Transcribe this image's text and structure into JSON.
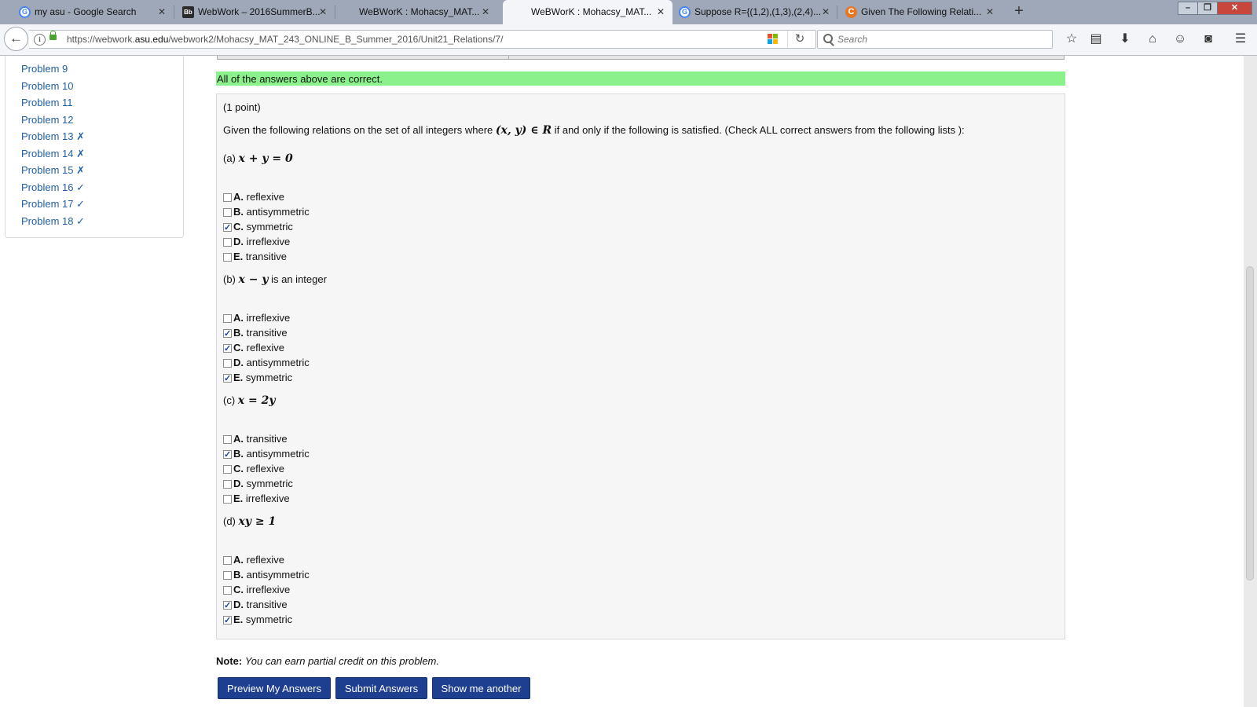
{
  "browser": {
    "tabs": [
      {
        "title": "my asu - Google Search",
        "icon": "google-icon",
        "active": false
      },
      {
        "title": "WebWork – 2016SummerB...",
        "icon": "blackboard-icon",
        "active": false
      },
      {
        "title": "WeBWorK : Mohacsy_MAT...",
        "icon": "none",
        "active": false
      },
      {
        "title": "WeBWorK : Mohacsy_MAT...",
        "icon": "none",
        "active": true
      },
      {
        "title": "Suppose R={(1,2),(1,3),(2,4)...",
        "icon": "google-icon",
        "active": false
      },
      {
        "title": "Given The Following Relati...",
        "icon": "chegg-icon",
        "active": false
      }
    ],
    "new_tab": "+",
    "url_prefix": "https://webwork.",
    "url_domain": "asu.edu",
    "url_path": "/webwork2/Mohacsy_MAT_243_ONLINE_B_Summer_2016/Unit21_Relations/7/",
    "search_placeholder": "Search"
  },
  "sidebar": {
    "problems": [
      "Problem 9",
      "Problem 10",
      "Problem 11",
      "Problem 12",
      "Problem 13 ✗",
      "Problem 14 ✗",
      "Problem 15 ✗",
      "Problem 16 ✓",
      "Problem 17 ✓",
      "Problem 18 ✓"
    ]
  },
  "result_message": "All of the answers above are correct.",
  "problem": {
    "points": "(1 point)",
    "intro_before": "Given the following relations on the set of all integers where",
    "intro_math": "(x, y) ∈ R",
    "intro_after": "if and only if the following is satisfied. (Check ALL correct answers from the following lists ):",
    "parts": [
      {
        "label": "(a)",
        "math": "x + y = 0",
        "suffix": "",
        "options": [
          {
            "letter": "A.",
            "text": "reflexive",
            "checked": false
          },
          {
            "letter": "B.",
            "text": "antisymmetric",
            "checked": false
          },
          {
            "letter": "C.",
            "text": "symmetric",
            "checked": true
          },
          {
            "letter": "D.",
            "text": "irreflexive",
            "checked": false
          },
          {
            "letter": "E.",
            "text": "transitive",
            "checked": false
          }
        ]
      },
      {
        "label": "(b)",
        "math": "x − y",
        "suffix": "is an integer",
        "options": [
          {
            "letter": "A.",
            "text": "irreflexive",
            "checked": false
          },
          {
            "letter": "B.",
            "text": "transitive",
            "checked": true
          },
          {
            "letter": "C.",
            "text": "reflexive",
            "checked": true
          },
          {
            "letter": "D.",
            "text": "antisymmetric",
            "checked": false
          },
          {
            "letter": "E.",
            "text": "symmetric",
            "checked": true
          }
        ]
      },
      {
        "label": "(c)",
        "math": "x = 2y",
        "suffix": "",
        "options": [
          {
            "letter": "A.",
            "text": "transitive",
            "checked": false
          },
          {
            "letter": "B.",
            "text": "antisymmetric",
            "checked": true
          },
          {
            "letter": "C.",
            "text": "reflexive",
            "checked": false
          },
          {
            "letter": "D.",
            "text": "symmetric",
            "checked": false
          },
          {
            "letter": "E.",
            "text": "irreflexive",
            "checked": false
          }
        ]
      },
      {
        "label": "(d)",
        "math": "xy ≥ 1",
        "suffix": "",
        "options": [
          {
            "letter": "A.",
            "text": "reflexive",
            "checked": false
          },
          {
            "letter": "B.",
            "text": "antisymmetric",
            "checked": false
          },
          {
            "letter": "C.",
            "text": "irreflexive",
            "checked": false
          },
          {
            "letter": "D.",
            "text": "transitive",
            "checked": true
          },
          {
            "letter": "E.",
            "text": "symmetric",
            "checked": true
          }
        ]
      }
    ]
  },
  "note": {
    "label": "Note:",
    "text": "You can earn partial credit on this problem."
  },
  "buttons": {
    "preview": "Preview My Answers",
    "submit": "Submit Answers",
    "another": "Show me another"
  },
  "colors": {
    "correct_bg": "#8bf28b",
    "link": "#1f5fa6",
    "button_bg": "#1e3f8f"
  }
}
